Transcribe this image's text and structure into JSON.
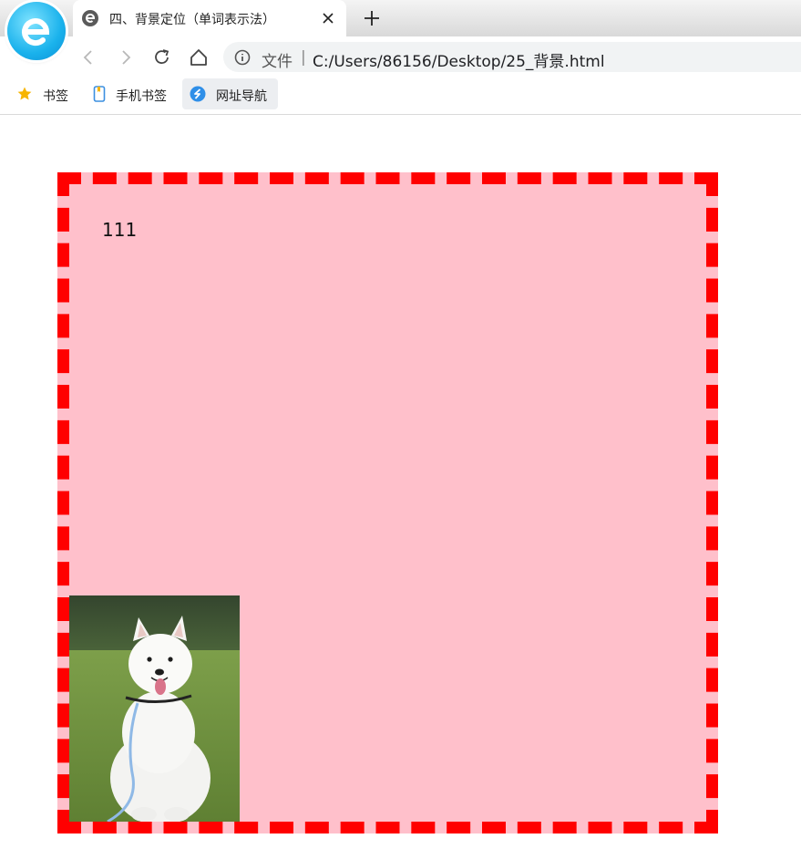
{
  "browser": {
    "tab": {
      "title": "四、背景定位（单词表示法）"
    },
    "address_bar": {
      "scheme_label": "文件",
      "separator": "|",
      "url": "C:/Users/86156/Desktop/25_背景.html"
    },
    "bookmarks": [
      {
        "label": "书签",
        "icon": "star-icon"
      },
      {
        "label": "手机书签",
        "icon": "phone-bookmark-icon"
      },
      {
        "label": "网址导航",
        "icon": "navigation-icon"
      }
    ]
  },
  "page": {
    "box": {
      "text": "111",
      "background_color": "#ffc0cb",
      "border_color": "#ff0000",
      "image": "samoyed-dog-photo"
    }
  },
  "colors": {
    "tab_strip": "#dedede",
    "omnibox": "#f1f3f4",
    "browser_logo": "#1ab2ec"
  }
}
